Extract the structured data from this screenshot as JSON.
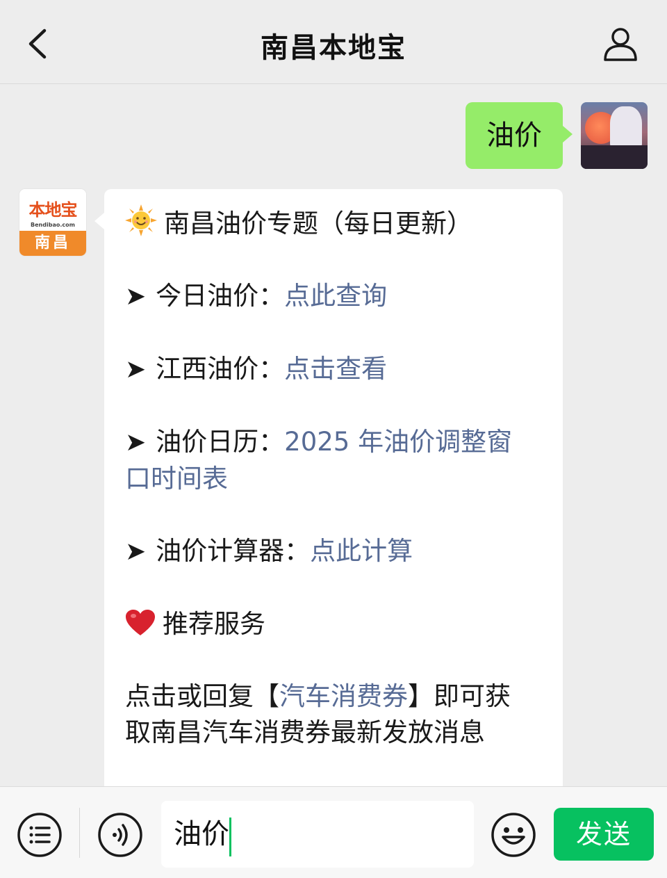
{
  "header": {
    "title": "南昌本地宝",
    "back_icon": "chevron-left-icon",
    "profile_icon": "person-icon"
  },
  "messages": {
    "outgoing": {
      "text": "油价"
    },
    "incoming": {
      "avatar": {
        "name_cn": "本地宝",
        "name_en": "Bendibao.com",
        "city": "南昌"
      },
      "title_emoji": "sun-face-emoji",
      "title": "南昌油价专题（每日更新）",
      "arrow": "➤",
      "items": [
        {
          "label": "今日油价：",
          "link": "点此查询"
        },
        {
          "label": "江西油价：",
          "link": "点击查看"
        },
        {
          "label": "油价日历：",
          "link_line1": "2025 年油价调整窗",
          "link_line2": "口时间表"
        },
        {
          "label": "油价计算器：",
          "link": "点此计算"
        }
      ],
      "service_emoji": "red-heart-emoji",
      "service_title": "推荐服务",
      "service_text_pre": "点击或回复【",
      "service_link": "汽车消费券",
      "service_text_post": "】即可获",
      "service_text_line2": "取南昌汽车消费券最新发放消息"
    }
  },
  "input_bar": {
    "menu_icon": "menu-list-icon",
    "voice_icon": "voice-icon",
    "input_value": "油价",
    "emoji_icon": "smiley-icon",
    "send_label": "发送"
  },
  "colors": {
    "link": "#576b95",
    "outgoing_bubble": "#95ec69",
    "send_button": "#07c160",
    "background": "#ededed"
  }
}
